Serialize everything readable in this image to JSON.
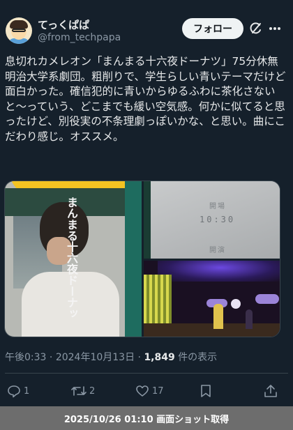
{
  "user": {
    "name": "てっくぱぱ",
    "handle": "@from_techpapa",
    "follow_label": "フォロー"
  },
  "tweet": {
    "text": "息切れカメレオン「まんまる十六夜ドーナツ」75分休無\n明治大学系劇団。粗削りで、学生らしい青いテーマだけど面白かった。確信犯的に青いからゆるふわに茶化さないと〜っていう、どこまでも緩い空気感。何かに似てると思ったけど、別役実の不条理劇っぽいかな、と思い。曲にこだわり感じ。オススメ。"
  },
  "media": {
    "poster_title": "まんまる十六夜ドーナッ",
    "ticket_line1": "開場",
    "ticket_time": "10:30",
    "ticket_line2": "開演"
  },
  "meta": {
    "time": "午後0:33",
    "date": "2024年10月13日",
    "views": "1,849",
    "views_suffix": "件の表示",
    "sep": "·"
  },
  "actions": {
    "replies": "1",
    "reposts": "2",
    "likes": "17"
  },
  "footer": {
    "caption": "2025/10/26 01:10 画面ショット取得"
  },
  "icons": {
    "grok": "grok-icon",
    "more": "more-icon",
    "reply": "reply-icon",
    "repost": "repost-icon",
    "like": "heart-icon",
    "bookmark": "bookmark-icon",
    "share": "share-icon"
  },
  "colors": {
    "background": "#15202b",
    "text": "#e7e9ea",
    "muted": "#8b98a5",
    "follow_bg": "#eff3f4",
    "footer_bg": "#6d6d6d"
  }
}
